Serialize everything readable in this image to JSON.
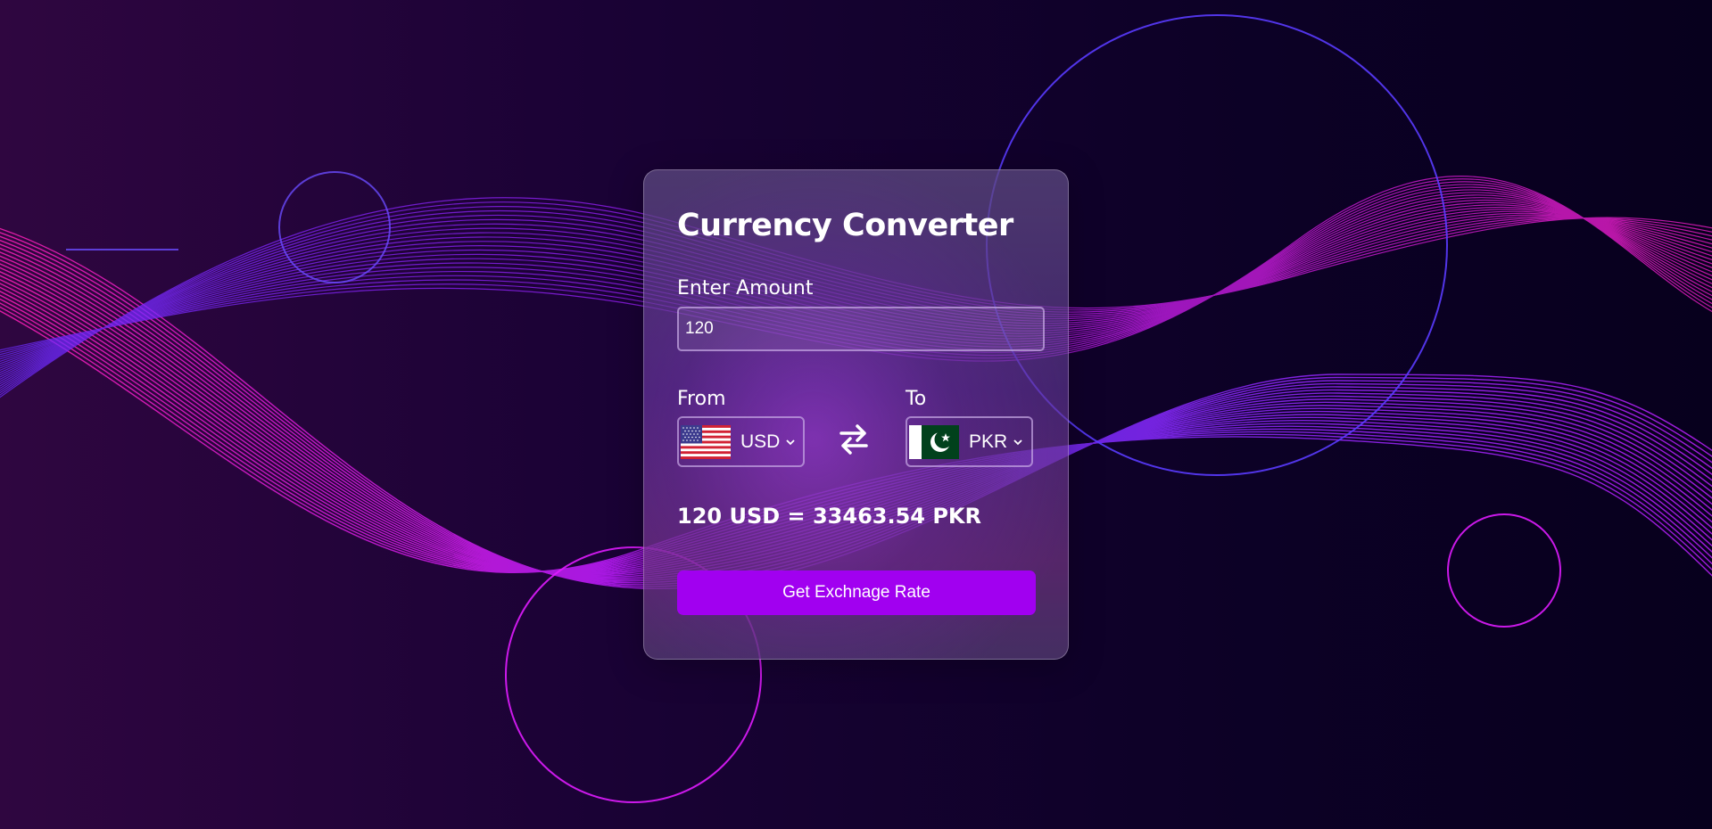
{
  "converter": {
    "title": "Currency Converter",
    "amount_label": "Enter Amount",
    "amount_value": "120",
    "from_label": "From",
    "to_label": "To",
    "from_currency": "USD",
    "to_currency": "PKR",
    "from_flag_icon": "us-flag-icon",
    "to_flag_icon": "pk-flag-icon",
    "swap_icon": "swap-arrows-icon",
    "result_text": "120 USD = 33463.54 PKR",
    "button_label": "Get Exchnage Rate"
  },
  "colors": {
    "button": "#a100f0",
    "text": "#ffffff",
    "background_dark": "#07001d",
    "accent_magenta": "#ff1fd0",
    "accent_violet": "#6a2cff"
  }
}
